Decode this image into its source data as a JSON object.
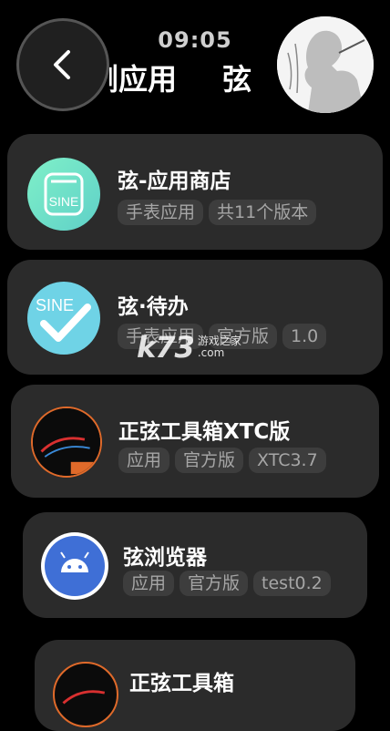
{
  "status_bar": {
    "time": "09:05"
  },
  "header": {
    "title_left": "浏应用",
    "title_right": "弦"
  },
  "apps": [
    {
      "name": "弦-应用商店",
      "tags": [
        "手表应用",
        "共11个版本"
      ],
      "icon": "sine-store-icon"
    },
    {
      "name": "弦·待办",
      "tags": [
        "手表应用",
        "官方版",
        "1.0"
      ],
      "icon": "sine-todo-icon"
    },
    {
      "name": "正弦工具箱XTC版",
      "tags": [
        "应用",
        "官方版",
        "XTC3.7"
      ],
      "icon": "toolbox-xtc-icon"
    },
    {
      "name": "弦浏览器",
      "tags": [
        "应用",
        "官方版",
        "test0.2"
      ],
      "icon": "android-icon"
    },
    {
      "name": "正弦工具箱",
      "tags": [],
      "icon": "toolbox-icon"
    }
  ],
  "watermark": {
    "logo": "k73",
    "text": "游戏之家",
    "domain": ".com"
  },
  "colors": {
    "background": "#000000",
    "card": "#2b2b2b",
    "tag_bg": "#3d3d3d",
    "tag_text": "#a6a6a6",
    "store_icon": "#6fe0c0",
    "todo_icon": "#6fd6e6",
    "android_blue": "#3f6fd6"
  }
}
